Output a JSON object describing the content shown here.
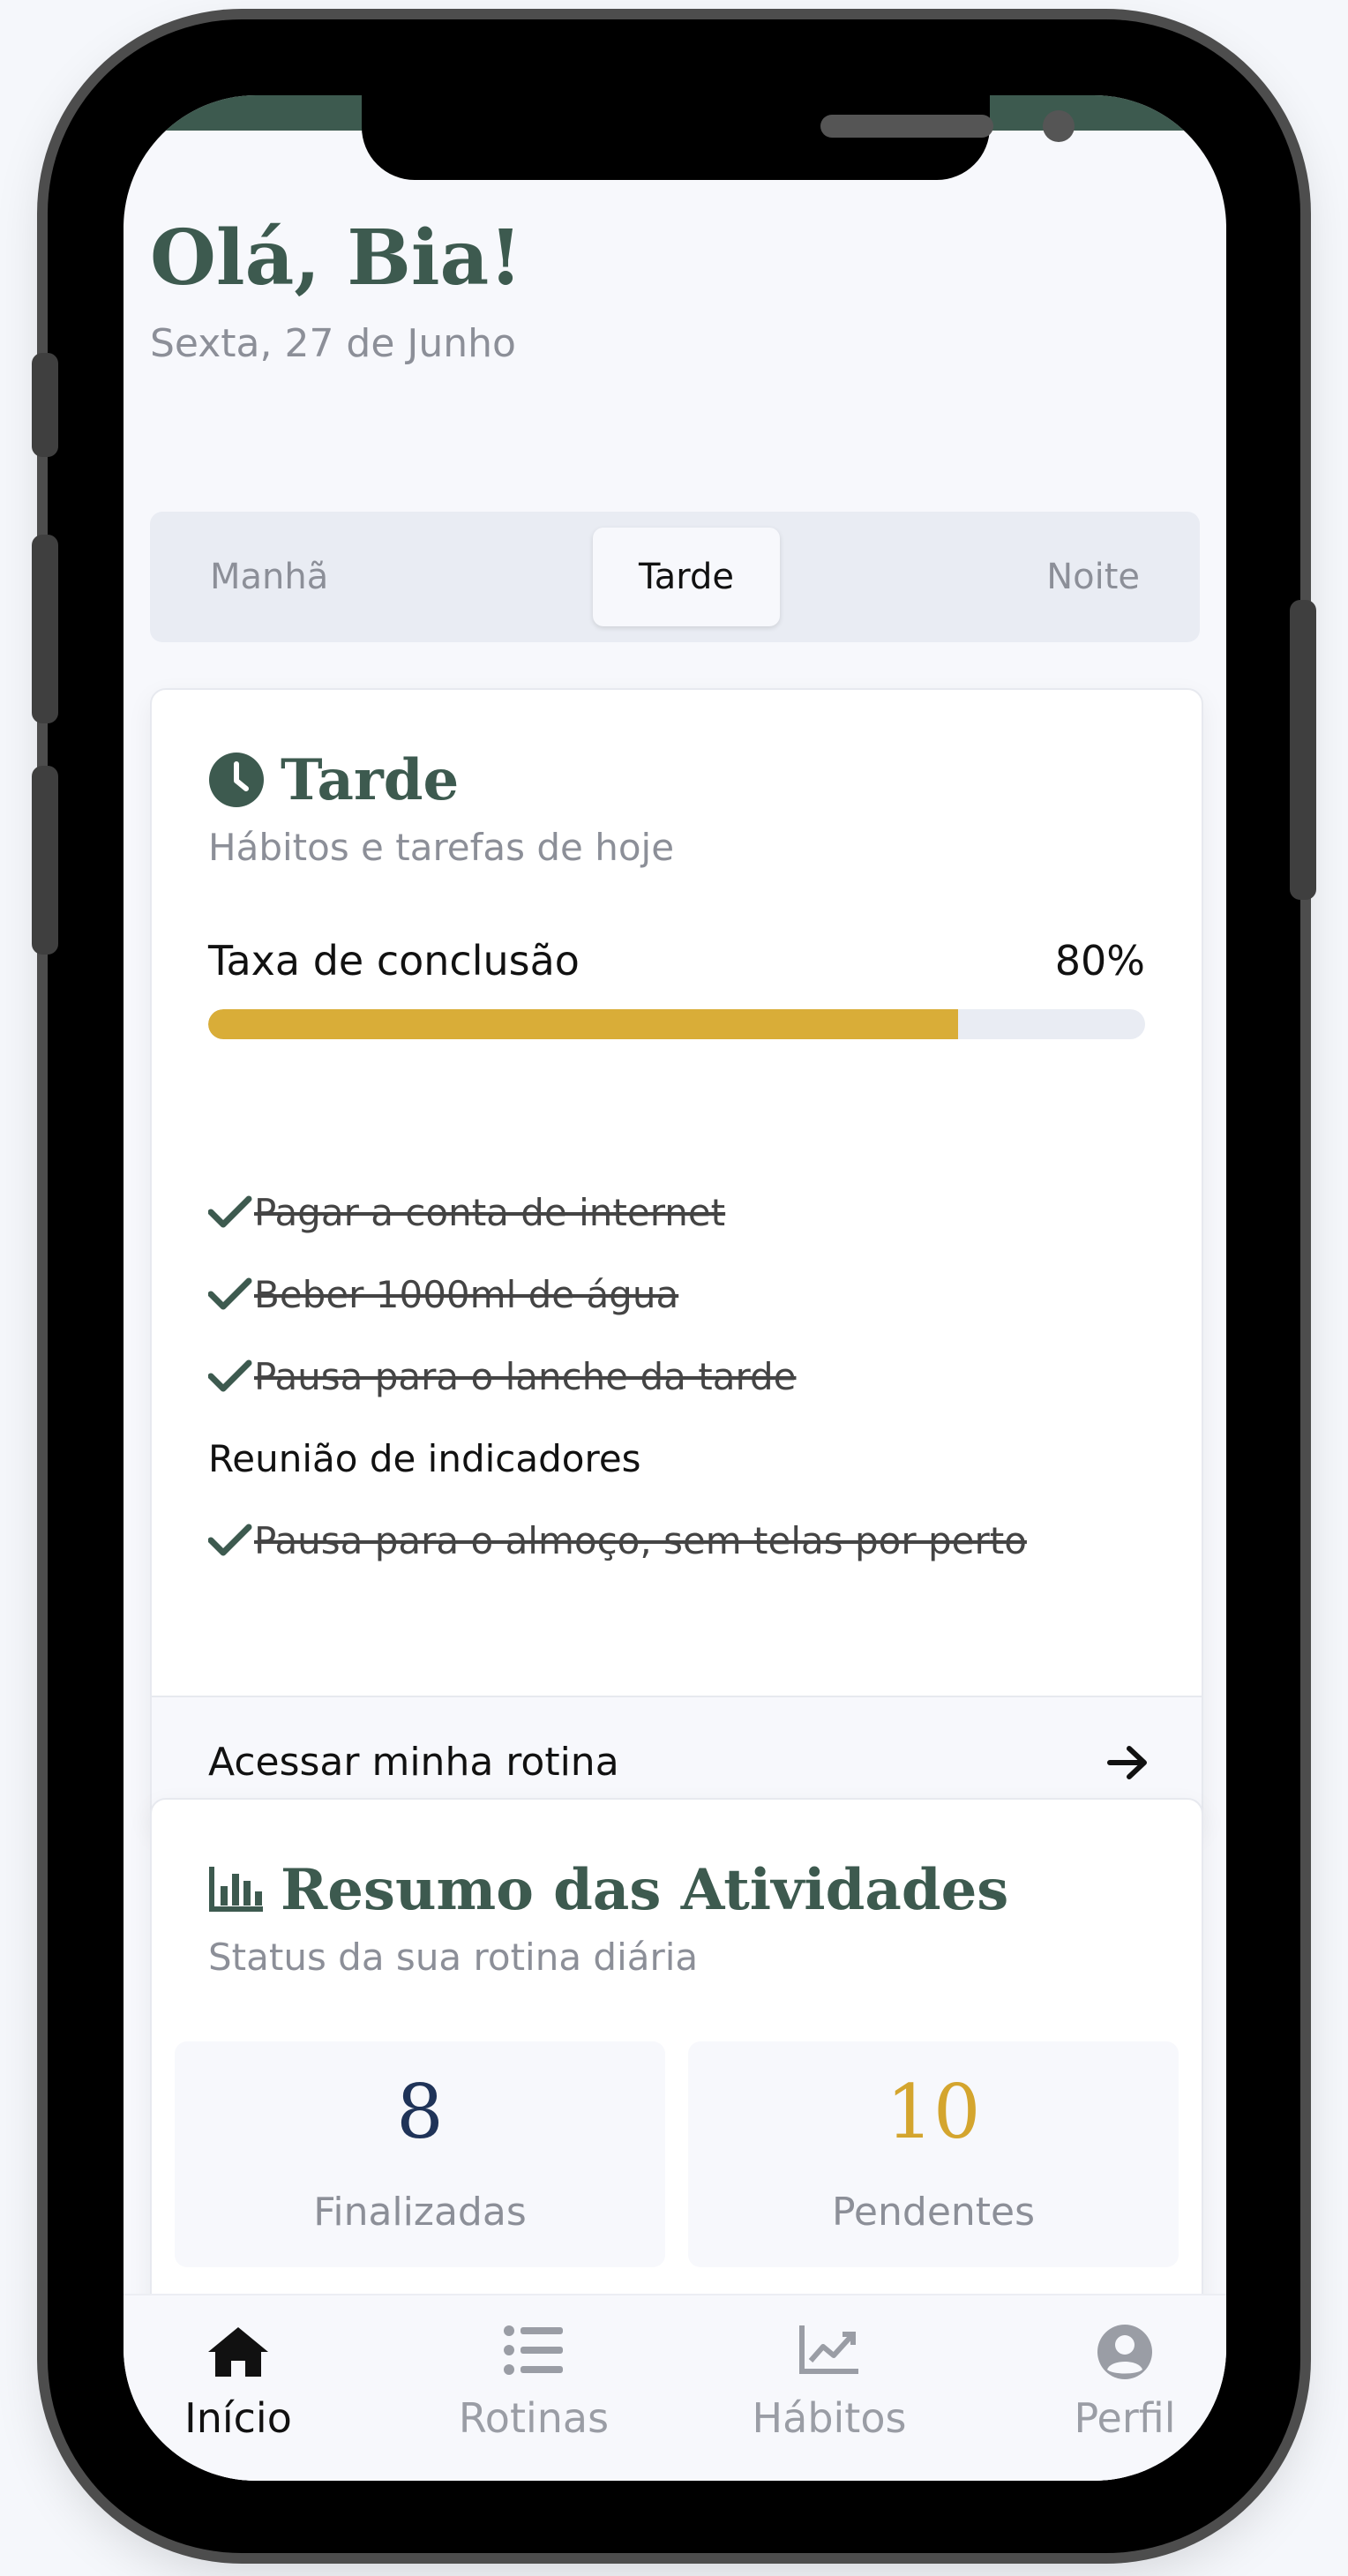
{
  "header": {
    "greeting": "Olá, Bia!",
    "date": "Sexta, 27 de Junho"
  },
  "period_tabs": {
    "items": [
      "Manhã",
      "Tarde",
      "Noite"
    ],
    "selected": "Tarde"
  },
  "routine_card": {
    "icon": "clock-icon",
    "title": "Tarde",
    "subtitle": "Hábitos e tarefas de hoje",
    "completion_label": "Taxa de conclusão",
    "completion_value": "80%",
    "completion_percent": 80,
    "tasks": [
      {
        "label": "Pagar a conta de internet",
        "done": true
      },
      {
        "label": "Beber 1000ml de água",
        "done": true
      },
      {
        "label": "Pausa para o lanche da tarde",
        "done": true
      },
      {
        "label": "Reunião de indicadores",
        "done": false
      },
      {
        "label": "Pausa para o almoço, sem telas por perto",
        "done": true
      }
    ],
    "footer_label": "Acessar minha rotina"
  },
  "summary_card": {
    "icon": "chart-bar-icon",
    "title": "Resumo das Atividades",
    "subtitle": "Status da sua rotina diária",
    "finished_count": "8",
    "finished_label": "Finalizadas",
    "pending_count": "10",
    "pending_label": "Pendentes"
  },
  "bottom_nav": {
    "items": [
      {
        "label": "Início",
        "icon": "home-icon",
        "active": true
      },
      {
        "label": "Rotinas",
        "icon": "list-icon",
        "active": false
      },
      {
        "label": "Hábitos",
        "icon": "chart-line-icon",
        "active": false
      },
      {
        "label": "Perfil",
        "icon": "user-circle-icon",
        "active": false
      }
    ]
  },
  "colors": {
    "primary_green": "#3d5a4f",
    "progress_gold": "#d9ad38",
    "finished_navy": "#1f3358",
    "pending_gold": "#d4a52e"
  }
}
